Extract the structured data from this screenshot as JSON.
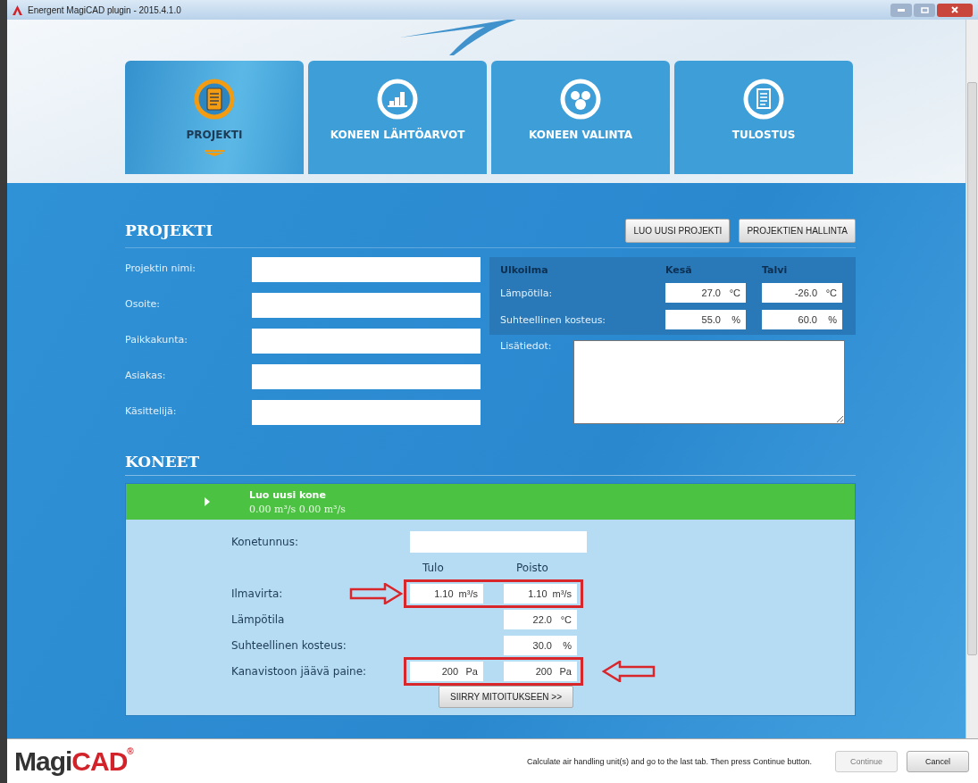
{
  "window": {
    "title": "Energent MagiCAD plugin - 2015.4.1.0"
  },
  "tabs": [
    {
      "label": "PROJEKTI",
      "selected": true
    },
    {
      "label": "KONEEN LÄHTÖARVOT",
      "selected": false
    },
    {
      "label": "KONEEN VALINTA",
      "selected": false
    },
    {
      "label": "TULOSTUS",
      "selected": false
    }
  ],
  "project": {
    "heading": "PROJEKTI",
    "buttons": [
      "LUO UUSI PROJEKTI",
      "PROJEKTIEN HALLINTA"
    ],
    "fields": [
      {
        "label": "Projektin nimi:"
      },
      {
        "label": "Osoite:"
      },
      {
        "label": "Paikkakunta:"
      },
      {
        "label": "Asiakas:"
      },
      {
        "label": "Käsittelijä:"
      }
    ],
    "outdoor": {
      "columns": [
        "Ulkoilma",
        "Kesä",
        "Talvi"
      ],
      "rows": [
        {
          "label": "Lämpötila:",
          "summer": {
            "value": "27.0",
            "unit": "°C"
          },
          "winter": {
            "value": "-26.0",
            "unit": "°C"
          }
        },
        {
          "label": "Suhteellinen kosteus:",
          "summer": {
            "value": "55.0",
            "unit": "%"
          },
          "winter": {
            "value": "60.0",
            "unit": "%"
          }
        }
      ]
    },
    "notes_label": "Lisätiedot:"
  },
  "machines": {
    "heading": "KONEET",
    "unit": {
      "title": "Luo uusi kone",
      "subtitle": "0.00 m³/s 0.00 m³/s",
      "id_label": "Konetunnus:",
      "columns": [
        "Tulo",
        "Poisto"
      ],
      "rows": [
        {
          "label": "Ilmavirta:",
          "supply": {
            "value": "1.10",
            "unit": "m³/s"
          },
          "exhaust": {
            "value": "1.10",
            "unit": "m³/s"
          },
          "highlighted": true,
          "arrow_before": true,
          "arrow_after": false
        },
        {
          "label": "Lämpötila",
          "exhaust": {
            "value": "22.0",
            "unit": "°C"
          },
          "highlighted": false,
          "arrow_before": false,
          "arrow_after": false
        },
        {
          "label": "Suhteellinen kosteus:",
          "exhaust": {
            "value": "30.0",
            "unit": "%"
          },
          "highlighted": false,
          "arrow_before": false,
          "arrow_after": false
        },
        {
          "label": "Kanavistoon jäävä paine:",
          "supply": {
            "value": "200",
            "unit": "Pa"
          },
          "exhaust": {
            "value": "200",
            "unit": "Pa"
          },
          "highlighted": true,
          "arrow_before": false,
          "arrow_after": true
        }
      ],
      "button": "SIIRRY MITOITUKSEEN >>"
    }
  },
  "footer": {
    "logo": {
      "part_1": "Magi",
      "part_2": "CAD",
      "mark": "®"
    },
    "message": "Calculate air handling unit(s) and go to the last tab. Then press Continue button.",
    "buttons": [
      {
        "label": "Continue",
        "disabled": true
      },
      {
        "label": "Cancel",
        "disabled": false
      }
    ]
  }
}
